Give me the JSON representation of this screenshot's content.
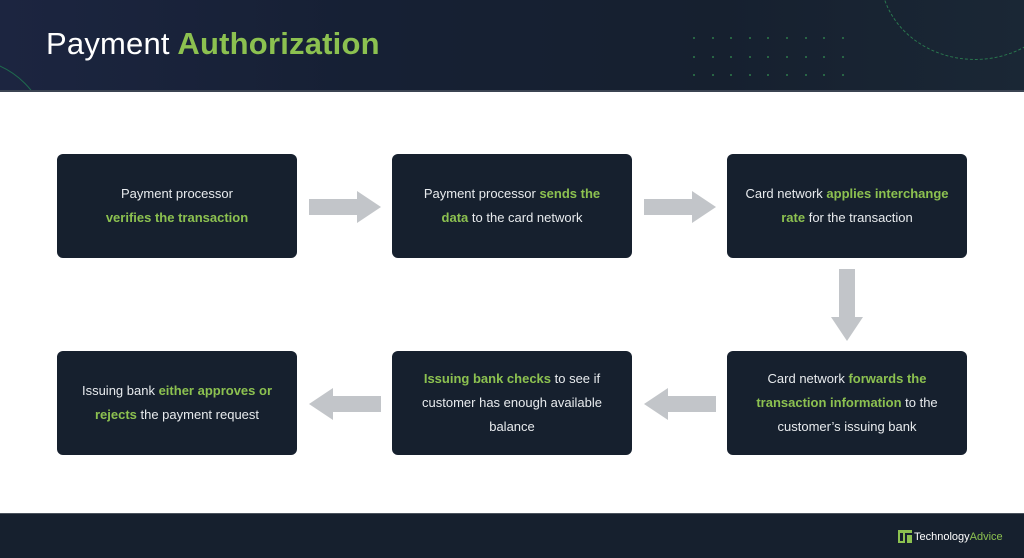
{
  "header": {
    "title_plain": "Payment",
    "title_accent": "Authorization"
  },
  "colors": {
    "accent": "#8cc150",
    "box_bg": "#16202e",
    "arrow": "#c2c5c9",
    "header_bg": "#16202f"
  },
  "steps": [
    {
      "id": 1,
      "pre": "Payment processor",
      "hl": "verifies the transaction",
      "post": "",
      "break_after_pre": true
    },
    {
      "id": 2,
      "pre": "Payment processor ",
      "hl": "sends the data",
      "post": " to the card network"
    },
    {
      "id": 3,
      "pre": "Card network ",
      "hl": "applies interchange rate",
      "post": " for the transaction"
    },
    {
      "id": 4,
      "pre": "Card network ",
      "hl": "forwards the transaction information",
      "post": " to the customer’s issuing bank"
    },
    {
      "id": 5,
      "pre": "",
      "hl": "Issuing bank checks",
      "post": " to see if customer has enough available balance"
    },
    {
      "id": 6,
      "pre": "Issuing bank ",
      "hl": "either approves or rejects",
      "post": " the payment request"
    }
  ],
  "arrows": [
    {
      "from": 1,
      "to": 2,
      "direction": "right",
      "icon": "arrow-right-icon"
    },
    {
      "from": 2,
      "to": 3,
      "direction": "right",
      "icon": "arrow-right-icon"
    },
    {
      "from": 3,
      "to": 4,
      "direction": "down",
      "icon": "arrow-down-icon"
    },
    {
      "from": 4,
      "to": 5,
      "direction": "left",
      "icon": "arrow-left-icon"
    },
    {
      "from": 5,
      "to": 6,
      "direction": "left",
      "icon": "arrow-left-icon"
    }
  ],
  "footer": {
    "brand_part1": "Technology",
    "brand_part2": "Advice"
  }
}
